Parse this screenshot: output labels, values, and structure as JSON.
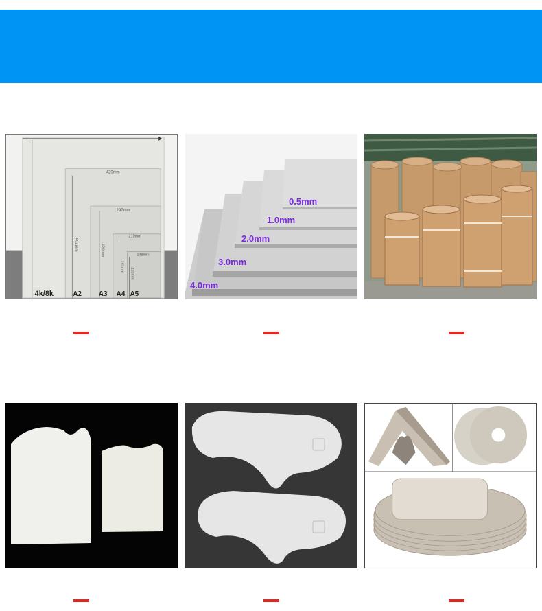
{
  "row1": {
    "sizes_tile": {
      "dims": [
        "420mm",
        "297mm",
        "210mm",
        "148mm"
      ],
      "vdims": [
        "594mm",
        "420mm",
        "297mm",
        "210mm"
      ],
      "formats": [
        "4k/8k",
        "A2",
        "A3",
        "A4",
        "A5"
      ]
    },
    "thickness_tile": {
      "labels": [
        "0.5mm",
        "1.0mm",
        "2.0mm",
        "3.0mm",
        "4.0mm"
      ]
    },
    "rolls_tile": {}
  },
  "row2": {
    "tiles": [
      "sleeve-cards",
      "insole-shapes",
      "custom-shapes"
    ]
  },
  "colors": {
    "banner": "#0095f5",
    "accent_dash": "#e8261f",
    "thickness_label": "#7a2be0"
  }
}
